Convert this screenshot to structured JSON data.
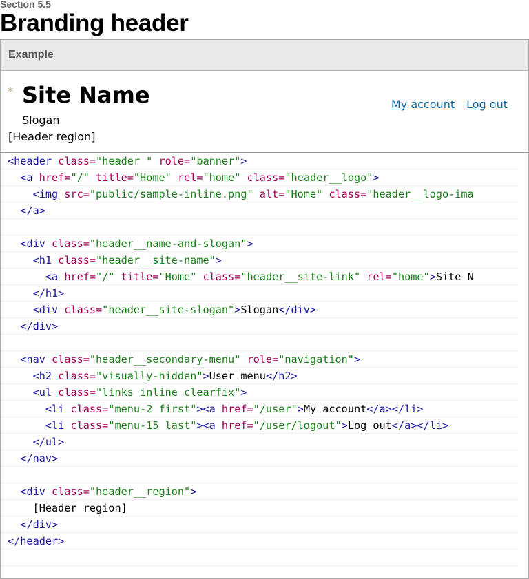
{
  "section_label": "Section 5.5",
  "title": "Branding header",
  "example_label": "Example",
  "demo": {
    "site_name": "Site Name",
    "slogan": "Slogan",
    "header_region": "[Header region]",
    "menu": [
      "My account",
      "Log out"
    ]
  },
  "code_lines": [
    [
      [
        "t",
        "<header "
      ],
      [
        "a",
        "class="
      ],
      [
        "s",
        "\"header \""
      ],
      [
        "a",
        " role="
      ],
      [
        "s",
        "\"banner\""
      ],
      [
        "t",
        ">"
      ]
    ],
    [
      [
        "x",
        "  "
      ],
      [
        "t",
        "<a "
      ],
      [
        "a",
        "href="
      ],
      [
        "s",
        "\"/\""
      ],
      [
        "a",
        " title="
      ],
      [
        "s",
        "\"Home\""
      ],
      [
        "a",
        " rel="
      ],
      [
        "s",
        "\"home\""
      ],
      [
        "a",
        " class="
      ],
      [
        "s",
        "\"header__logo\""
      ],
      [
        "t",
        ">"
      ]
    ],
    [
      [
        "x",
        "    "
      ],
      [
        "t",
        "<img "
      ],
      [
        "a",
        "src="
      ],
      [
        "s",
        "\"public/sample-inline.png\""
      ],
      [
        "a",
        " alt="
      ],
      [
        "s",
        "\"Home\""
      ],
      [
        "a",
        " class="
      ],
      [
        "s",
        "\"header__logo-ima"
      ]
    ],
    [
      [
        "x",
        "  "
      ],
      [
        "t",
        "</a>"
      ]
    ],
    [],
    [
      [
        "x",
        "  "
      ],
      [
        "t",
        "<div "
      ],
      [
        "a",
        "class="
      ],
      [
        "s",
        "\"header__name-and-slogan\""
      ],
      [
        "t",
        ">"
      ]
    ],
    [
      [
        "x",
        "    "
      ],
      [
        "t",
        "<h1 "
      ],
      [
        "a",
        "class="
      ],
      [
        "s",
        "\"header__site-name\""
      ],
      [
        "t",
        ">"
      ]
    ],
    [
      [
        "x",
        "      "
      ],
      [
        "t",
        "<a "
      ],
      [
        "a",
        "href="
      ],
      [
        "s",
        "\"/\""
      ],
      [
        "a",
        " title="
      ],
      [
        "s",
        "\"Home\""
      ],
      [
        "a",
        " class="
      ],
      [
        "s",
        "\"header__site-link\""
      ],
      [
        "a",
        " rel="
      ],
      [
        "s",
        "\"home\""
      ],
      [
        "t",
        ">"
      ],
      [
        "x",
        "Site N"
      ]
    ],
    [
      [
        "x",
        "    "
      ],
      [
        "t",
        "</h1>"
      ]
    ],
    [
      [
        "x",
        "    "
      ],
      [
        "t",
        "<div "
      ],
      [
        "a",
        "class="
      ],
      [
        "s",
        "\"header__site-slogan\""
      ],
      [
        "t",
        ">"
      ],
      [
        "x",
        "Slogan"
      ],
      [
        "t",
        "</div>"
      ]
    ],
    [
      [
        "x",
        "  "
      ],
      [
        "t",
        "</div>"
      ]
    ],
    [],
    [
      [
        "x",
        "  "
      ],
      [
        "t",
        "<nav "
      ],
      [
        "a",
        "class="
      ],
      [
        "s",
        "\"header__secondary-menu\""
      ],
      [
        "a",
        " role="
      ],
      [
        "s",
        "\"navigation\""
      ],
      [
        "t",
        ">"
      ]
    ],
    [
      [
        "x",
        "    "
      ],
      [
        "t",
        "<h2 "
      ],
      [
        "a",
        "class="
      ],
      [
        "s",
        "\"visually-hidden\""
      ],
      [
        "t",
        ">"
      ],
      [
        "x",
        "User menu"
      ],
      [
        "t",
        "</h2>"
      ]
    ],
    [
      [
        "x",
        "    "
      ],
      [
        "t",
        "<ul "
      ],
      [
        "a",
        "class="
      ],
      [
        "s",
        "\"links inline clearfix\""
      ],
      [
        "t",
        ">"
      ]
    ],
    [
      [
        "x",
        "      "
      ],
      [
        "t",
        "<li "
      ],
      [
        "a",
        "class="
      ],
      [
        "s",
        "\"menu-2 first\""
      ],
      [
        "t",
        "><a "
      ],
      [
        "a",
        "href="
      ],
      [
        "s",
        "\"/user\""
      ],
      [
        "t",
        ">"
      ],
      [
        "x",
        "My account"
      ],
      [
        "t",
        "</a></li>"
      ]
    ],
    [
      [
        "x",
        "      "
      ],
      [
        "t",
        "<li "
      ],
      [
        "a",
        "class="
      ],
      [
        "s",
        "\"menu-15 last\""
      ],
      [
        "t",
        "><a "
      ],
      [
        "a",
        "href="
      ],
      [
        "s",
        "\"/user/logout\""
      ],
      [
        "t",
        ">"
      ],
      [
        "x",
        "Log out"
      ],
      [
        "t",
        "</a></li>"
      ]
    ],
    [
      [
        "x",
        "    "
      ],
      [
        "t",
        "</ul>"
      ]
    ],
    [
      [
        "x",
        "  "
      ],
      [
        "t",
        "</nav>"
      ]
    ],
    [],
    [
      [
        "x",
        "  "
      ],
      [
        "t",
        "<div "
      ],
      [
        "a",
        "class="
      ],
      [
        "s",
        "\"header__region\""
      ],
      [
        "t",
        ">"
      ]
    ],
    [
      [
        "x",
        "    [Header region]"
      ]
    ],
    [
      [
        "x",
        "  "
      ],
      [
        "t",
        "</div>"
      ]
    ],
    [
      [
        "t",
        "</header>"
      ]
    ],
    []
  ]
}
